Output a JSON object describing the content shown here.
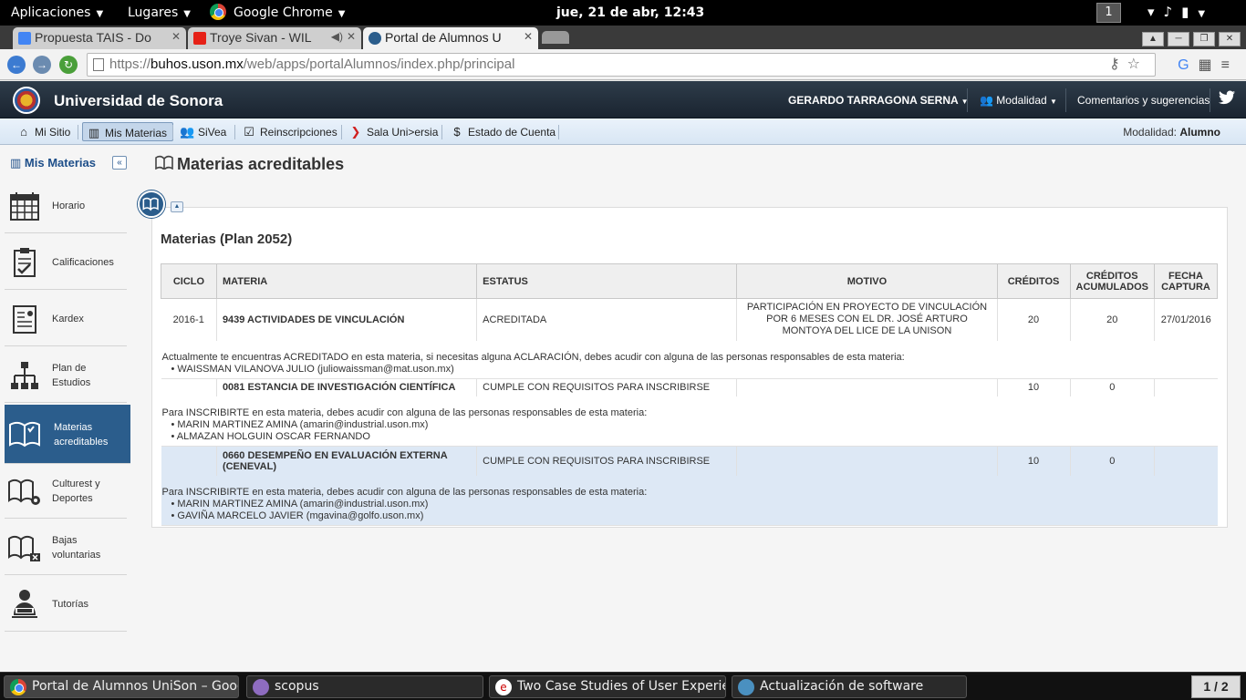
{
  "gnome_bar": {
    "applications": "Aplicaciones",
    "places": "Lugares",
    "active_app": "Google Chrome",
    "clock": "jue, 21 de abr, 12:43",
    "workspace": "1"
  },
  "browser": {
    "tabs": [
      {
        "label": "Propuesta TAIS - Do",
        "color": "#4285f4"
      },
      {
        "label": "Troye Sivan - WIL",
        "color": "#e62117"
      },
      {
        "label": "Portal de Alumnos U",
        "color": "#2b5d8c"
      }
    ],
    "url_scheme": "https://",
    "url_domain": "buhos.uson.mx",
    "url_path": "/web/apps/portalAlumnos/index.php/principal"
  },
  "portal": {
    "university": "Universidad de Sonora",
    "user": "GERARDO TARRAGONA SERNA",
    "modalidad_menu": "Modalidad",
    "comments": "Comentarios y sugerencias"
  },
  "menu": {
    "items": [
      "Mi Sitio",
      "Mis Materias",
      "SiVea",
      "Reinscripciones",
      "Sala Uni>ersia",
      "Estado de Cuenta"
    ],
    "modalidad_label": "Modalidad:",
    "modalidad_value": "Alumno"
  },
  "sidebar": {
    "title": "Mis Materias",
    "items": [
      "Horario",
      "Calificaciones",
      "Kardex",
      "Plan de Estudios",
      "Materias acreditables",
      "Culturest y Deportes",
      "Bajas voluntarias",
      "Tutorías"
    ]
  },
  "main": {
    "page_title": "Materias acreditables",
    "plan_title": "Materias (Plan 2052)",
    "columns": [
      "CICLO",
      "MATERIA",
      "ESTATUS",
      "MOTIVO",
      "CRÉDITOS",
      "CRÉDITOS ACUMULADOS",
      "FECHA CAPTURA"
    ],
    "rows": [
      {
        "ciclo": "2016-1",
        "materia": "9439 ACTIVIDADES DE VINCULACIÓN",
        "estatus": "ACREDITADA",
        "motivo": "PARTICIPACIÓN EN PROYECTO DE VINCULACIÓN POR 6 MESES CON EL DR. JOSÉ ARTURO MONTOYA DEL LICE DE LA UNISON",
        "creditos": "20",
        "acumulados": "20",
        "fecha": "27/01/2016",
        "note": "Actualmente te encuentras ACREDITADO en esta materia, si necesitas alguna ACLARACIÓN, debes acudir con alguna de las personas responsables de esta materia:",
        "contacts": [
          "• WAISSMAN VILANOVA JULIO (juliowaissman@mat.uson.mx)"
        ]
      },
      {
        "ciclo": "",
        "materia": "0081 ESTANCIA DE INVESTIGACIÓN CIENTÍFICA",
        "estatus": "CUMPLE CON REQUISITOS PARA INSCRIBIRSE",
        "motivo": "",
        "creditos": "10",
        "acumulados": "0",
        "fecha": "",
        "note": "Para INSCRIBIRTE en esta materia, debes acudir con alguna de las personas responsables de esta materia:",
        "contacts": [
          "• MARIN MARTINEZ AMINA (amarin@industrial.uson.mx)",
          "• ALMAZAN HOLGUIN OSCAR FERNANDO"
        ]
      },
      {
        "ciclo": "",
        "materia": "0660 DESEMPEÑO EN EVALUACIÓN EXTERNA (CENEVAL)",
        "estatus": "CUMPLE CON REQUISITOS PARA INSCRIBIRSE",
        "motivo": "",
        "creditos": "10",
        "acumulados": "0",
        "fecha": "",
        "note": "Para INSCRIBIRTE en esta materia, debes acudir con alguna de las personas responsables de esta materia:",
        "contacts": [
          "• MARIN MARTINEZ AMINA (amarin@industrial.uson.mx)",
          "• GAVIÑA MARCELO JAVIER (mgavina@golfo.uson.mx)"
        ]
      }
    ]
  },
  "taskbar": {
    "tasks": [
      "Portal de Alumnos UniSon – Goog...",
      "scopus",
      "Two Case Studies of User Experie...",
      "Actualización de software"
    ],
    "pager": "1 / 2"
  }
}
